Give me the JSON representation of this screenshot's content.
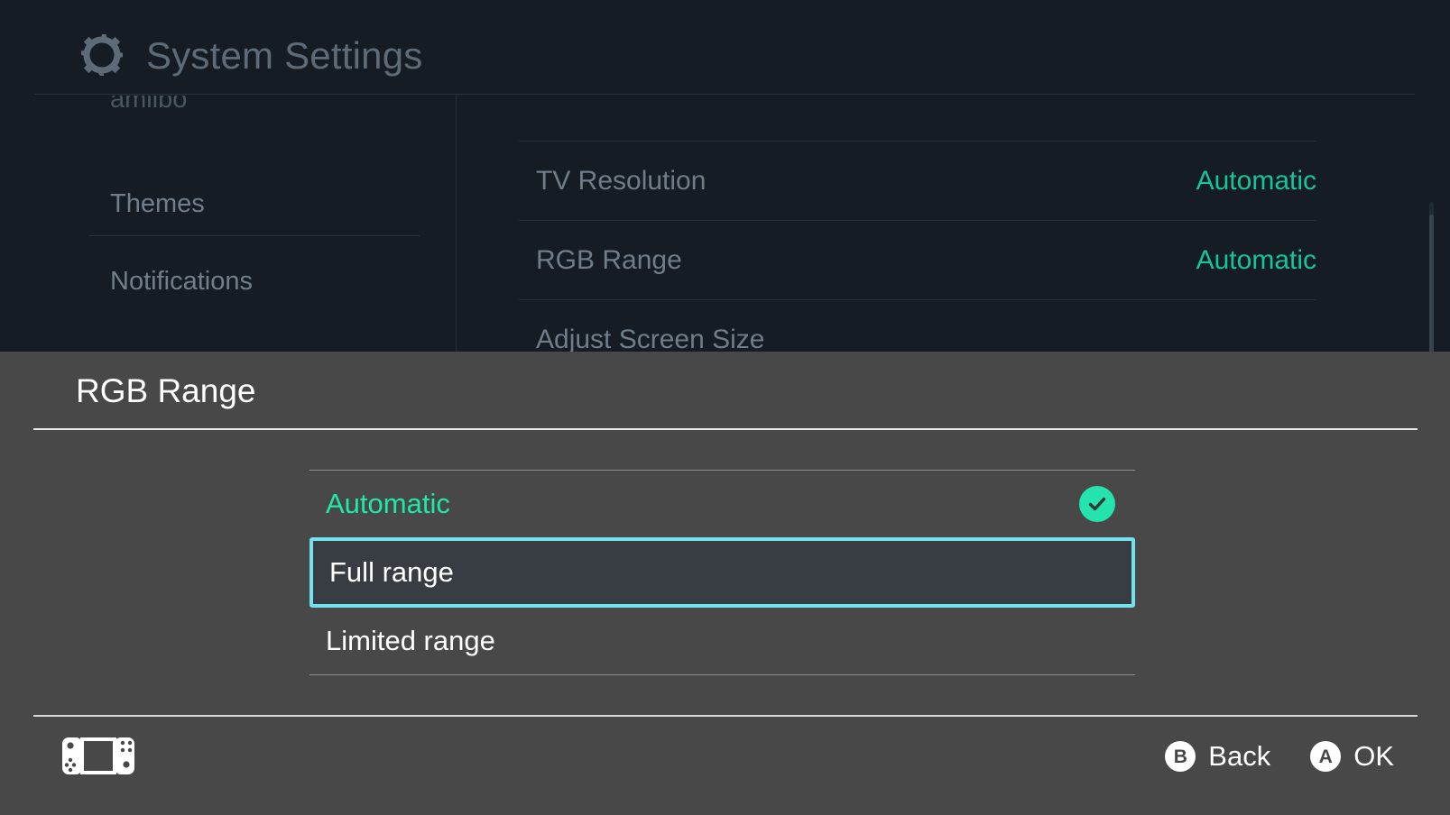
{
  "app": {
    "title": "System Settings",
    "gear_icon": "gear-icon",
    "accent_green": "#17c39a",
    "background": "#161c24"
  },
  "sidebar": {
    "items": [
      {
        "label": "amiibo",
        "cut_off": true
      },
      {
        "label": "Themes",
        "cut_off": false
      },
      {
        "label": "Notifications",
        "cut_off": false
      }
    ]
  },
  "settings": {
    "rows": [
      {
        "label": "TV Resolution",
        "value": "Automatic"
      },
      {
        "label": "RGB Range",
        "value": "Automatic"
      },
      {
        "label": "Adjust Screen Size",
        "value": ""
      }
    ]
  },
  "modal": {
    "title": "RGB Range",
    "focus_color": "#74e2ec",
    "selected_color": "#1de9a8",
    "options": [
      {
        "label": "Automatic",
        "checked": true,
        "focused": false
      },
      {
        "label": "Full range",
        "checked": false,
        "focused": true
      },
      {
        "label": "Limited range",
        "checked": false,
        "focused": false
      }
    ]
  },
  "footer": {
    "device_icon": "switch-console-icon",
    "hints": [
      {
        "button": "B",
        "label": "Back"
      },
      {
        "button": "A",
        "label": "OK"
      }
    ]
  }
}
